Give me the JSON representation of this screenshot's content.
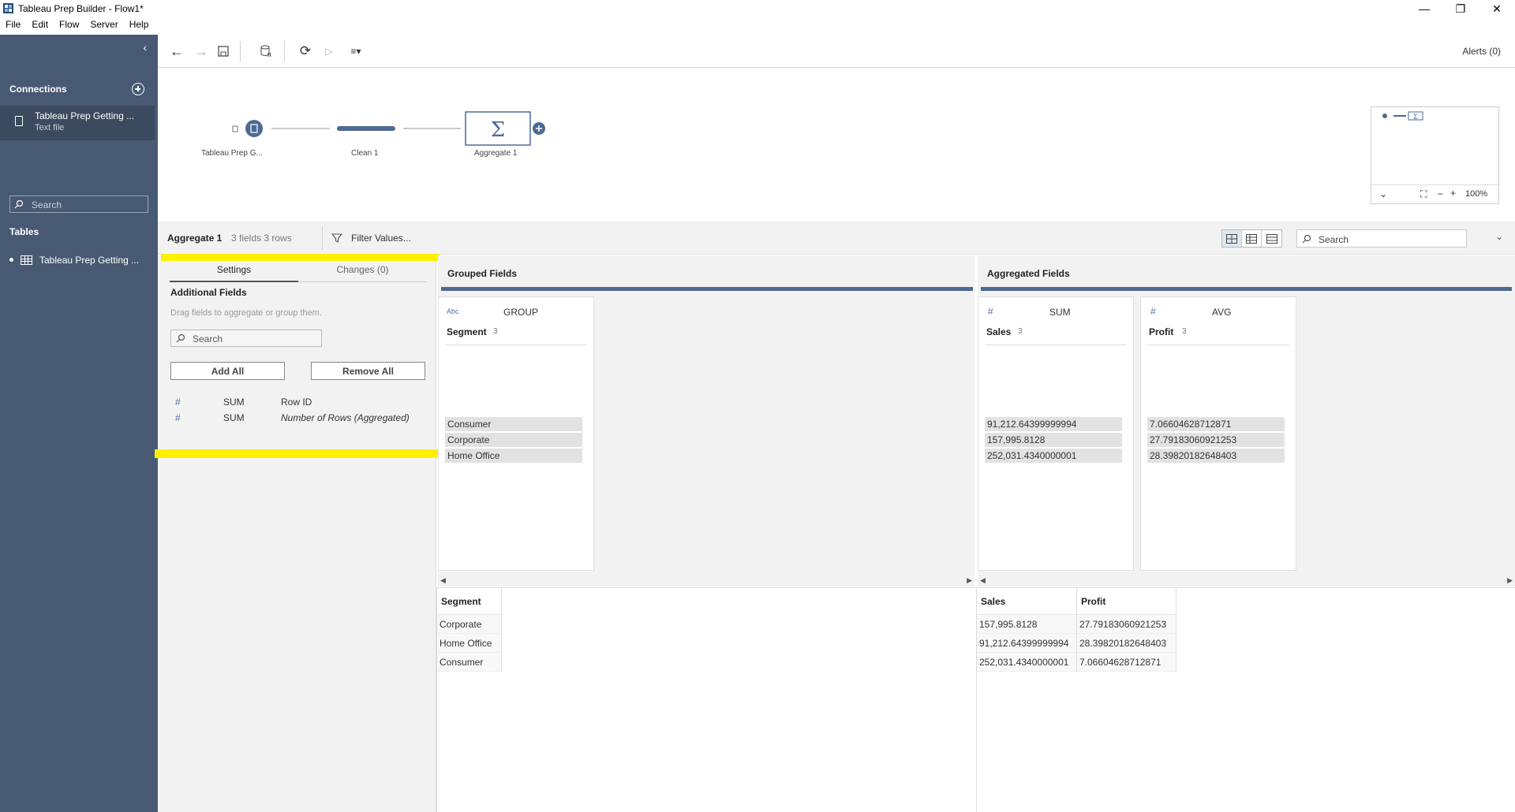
{
  "window": {
    "title": "Tableau Prep Builder - Flow1*"
  },
  "menu": [
    "File",
    "Edit",
    "Flow",
    "Server",
    "Help"
  ],
  "sidebar": {
    "connections_title": "Connections",
    "connection": {
      "name": "Tableau Prep Getting ...",
      "type": "Text file"
    },
    "search_placeholder": "Search",
    "tables_title": "Tables",
    "table": {
      "name": "Tableau Prep Getting ..."
    }
  },
  "toolbar": {
    "alerts": "Alerts (0)"
  },
  "flow": {
    "nodes": [
      {
        "label": "Tableau Prep G..."
      },
      {
        "label": "Clean 1"
      },
      {
        "label": "Aggregate 1"
      }
    ]
  },
  "minimap": {
    "zoom": "100%"
  },
  "step": {
    "name": "Aggregate 1",
    "meta": "3 fields  3 rows",
    "filter_label": "Filter Values...",
    "search_placeholder": "Search"
  },
  "settings": {
    "tabs": [
      "Settings",
      "Changes (0)"
    ],
    "header": "Additional Fields",
    "hint": "Drag fields to aggregate or group them.",
    "search_placeholder": "Search",
    "add_all": "Add All",
    "remove_all": "Remove All",
    "fields": [
      {
        "agg": "SUM",
        "name": "Row ID"
      },
      {
        "agg": "SUM",
        "name": "Number of Rows (Aggregated)"
      }
    ]
  },
  "grouped": {
    "title": "Grouped Fields",
    "card": {
      "type": "Abc",
      "agg": "GROUP",
      "name": "Segment",
      "count": "3",
      "values": [
        "Consumer",
        "Corporate",
        "Home Office"
      ]
    }
  },
  "aggregated": {
    "title": "Aggregated Fields",
    "cards": [
      {
        "agg": "SUM",
        "name": "Sales",
        "count": "3",
        "values": [
          "91,212.64399999994",
          "157,995.8128",
          "252,031.4340000001"
        ]
      },
      {
        "agg": "AVG",
        "name": "Profit",
        "count": "3",
        "values": [
          "7.06604628712871",
          "27.79183060921253",
          "28.39820182648403"
        ]
      }
    ]
  },
  "grid_left": {
    "header": "Segment",
    "rows": [
      "Corporate",
      "Home Office",
      "Consumer"
    ]
  },
  "grid_right": {
    "headers": [
      "Sales",
      "Profit"
    ],
    "rows": [
      [
        "157,995.8128",
        "27.79183060921253"
      ],
      [
        "91,212.64399999994",
        "28.39820182648403"
      ],
      [
        "252,031.4340000001",
        "7.06604628712871"
      ]
    ]
  },
  "colors": {
    "sidebar": "#485a73",
    "accent": "#4e6a93",
    "highlight": "#ffef00"
  }
}
